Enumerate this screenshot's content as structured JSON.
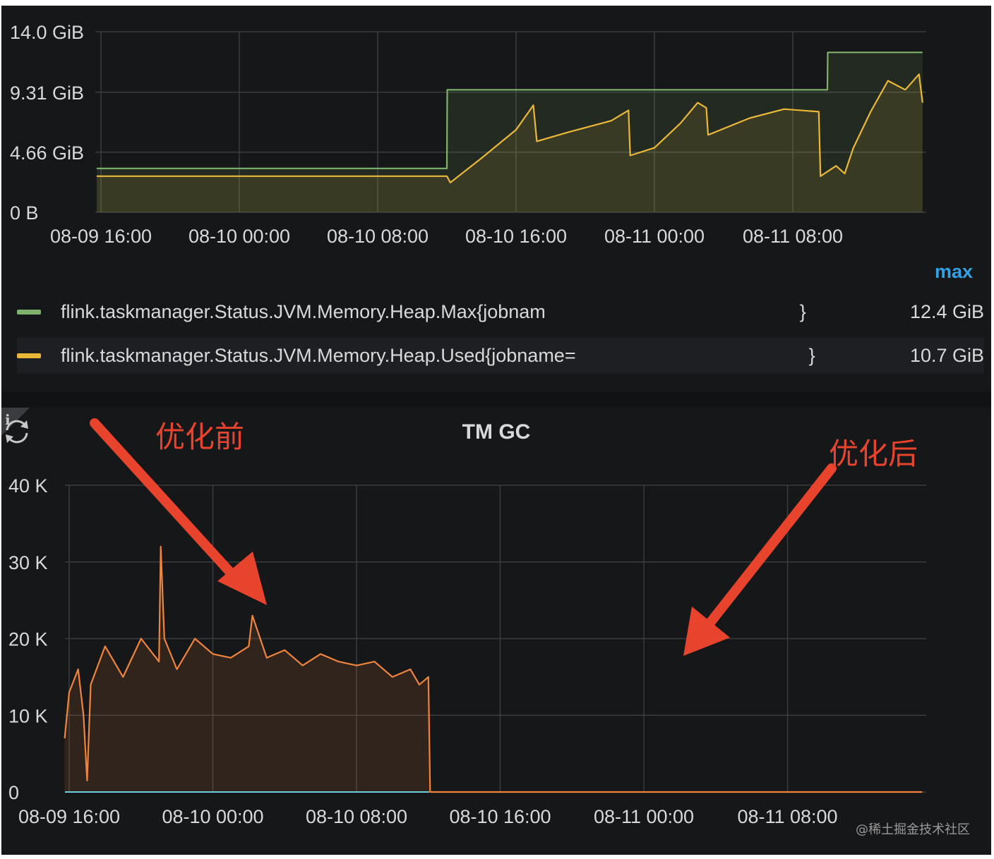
{
  "chart_data": [
    {
      "type": "area",
      "title": "",
      "y_ticks": [
        "14.0 GiB",
        "9.31 GiB",
        "4.66 GiB",
        "0 B"
      ],
      "y_tick_values": [
        14.0,
        9.31,
        4.66,
        0
      ],
      "ylim": [
        0,
        14.0
      ],
      "y_unit": "GiB",
      "x_ticks": [
        "08-09 16:00",
        "08-10 00:00",
        "08-10 08:00",
        "08-10 16:00",
        "08-11 00:00",
        "08-11 08:00"
      ],
      "x_range_hours": [
        0,
        48
      ],
      "grid": true,
      "legend_placement": "bottom",
      "legend_header": "max",
      "series": [
        {
          "name": "flink.taskmanager.Status.JVM.Memory.Heap.Max{jobnam",
          "name_suffix": "}",
          "max": "12.4 GiB",
          "color": "#7eb26d",
          "points": [
            [
              -0.25,
              3.4
            ],
            [
              20.0,
              3.4
            ],
            [
              20.02,
              9.5
            ],
            [
              42.0,
              9.5
            ],
            [
              42.02,
              12.4
            ],
            [
              47.5,
              12.4
            ]
          ]
        },
        {
          "name": "flink.taskmanager.Status.JVM.Memory.Heap.Used{jobname=",
          "name_suffix": "}",
          "max": "10.7 GiB",
          "color": "#eab839",
          "points": [
            [
              -0.25,
              2.8
            ],
            [
              20.0,
              2.8
            ],
            [
              20.2,
              2.3
            ],
            [
              22.0,
              4.2
            ],
            [
              24.0,
              6.4
            ],
            [
              25.0,
              8.3
            ],
            [
              25.2,
              5.5
            ],
            [
              27.0,
              6.2
            ],
            [
              29.5,
              7.1
            ],
            [
              30.5,
              7.9
            ],
            [
              30.6,
              4.4
            ],
            [
              32.0,
              5.0
            ],
            [
              33.5,
              6.9
            ],
            [
              34.5,
              8.5
            ],
            [
              35.0,
              8.1
            ],
            [
              35.1,
              6.0
            ],
            [
              37.5,
              7.3
            ],
            [
              39.5,
              8.0
            ],
            [
              41.5,
              7.8
            ],
            [
              41.6,
              2.8
            ],
            [
              42.5,
              3.6
            ],
            [
              43.0,
              3.0
            ],
            [
              43.5,
              5.0
            ],
            [
              44.5,
              7.8
            ],
            [
              45.5,
              10.2
            ],
            [
              46.5,
              9.5
            ],
            [
              47.3,
              10.7
            ],
            [
              47.5,
              8.5
            ]
          ]
        }
      ]
    },
    {
      "type": "area",
      "title": "TM GC",
      "y_ticks": [
        "40 K",
        "30 K",
        "20 K",
        "10 K",
        "0"
      ],
      "y_tick_values": [
        40000,
        30000,
        20000,
        10000,
        0
      ],
      "ylim": [
        0,
        40000
      ],
      "x_ticks": [
        "08-09 16:00",
        "08-10 00:00",
        "08-10 08:00",
        "08-10 16:00",
        "08-11 00:00",
        "08-11 08:00"
      ],
      "x_range_hours": [
        0,
        48
      ],
      "grid": true,
      "series": [
        {
          "color": "#ef843c",
          "points": [
            [
              -0.25,
              7000
            ],
            [
              0.0,
              13000
            ],
            [
              0.5,
              16000
            ],
            [
              0.8,
              10000
            ],
            [
              1.0,
              1500
            ],
            [
              1.2,
              14000
            ],
            [
              2.0,
              19000
            ],
            [
              3.0,
              15000
            ],
            [
              4.0,
              20000
            ],
            [
              5.0,
              17000
            ],
            [
              5.1,
              32000
            ],
            [
              5.3,
              20000
            ],
            [
              6.0,
              16000
            ],
            [
              7.0,
              20000
            ],
            [
              8.0,
              18000
            ],
            [
              9.0,
              17500
            ],
            [
              10.0,
              19000
            ],
            [
              10.2,
              23000
            ],
            [
              11.0,
              17500
            ],
            [
              12.0,
              18500
            ],
            [
              13.0,
              16500
            ],
            [
              14.0,
              18000
            ],
            [
              15.0,
              17000
            ],
            [
              16.0,
              16500
            ],
            [
              17.0,
              17000
            ],
            [
              18.0,
              15000
            ],
            [
              19.0,
              16000
            ],
            [
              19.5,
              14000
            ],
            [
              20.0,
              15000
            ],
            [
              20.1,
              0
            ],
            [
              47.5,
              0
            ]
          ]
        }
      ]
    }
  ],
  "annotations": {
    "before": "优化前",
    "after": "优化后"
  },
  "watermark": "@稀土掘金技术社区"
}
